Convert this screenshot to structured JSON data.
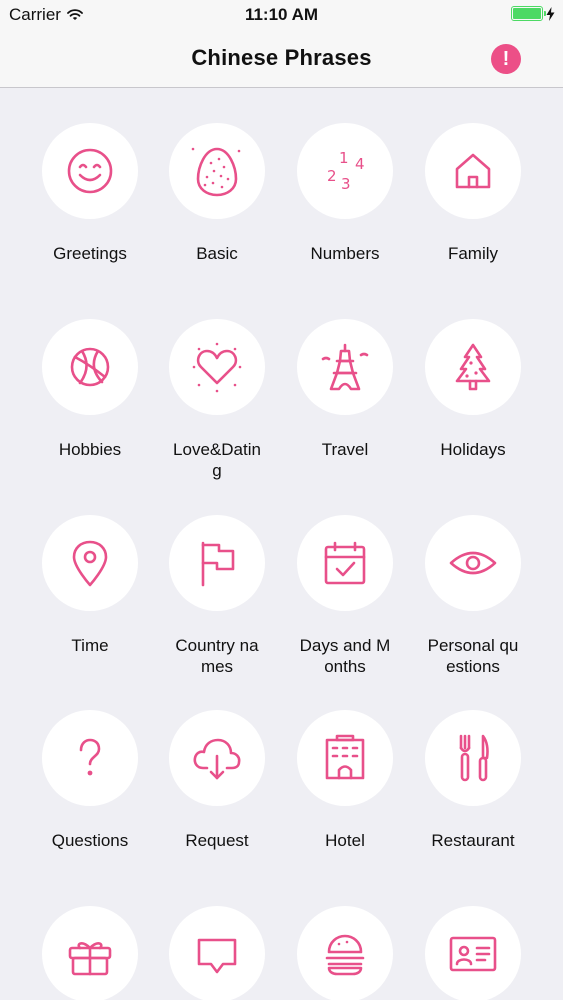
{
  "status_bar": {
    "carrier": "Carrier",
    "time": "11:10 AM"
  },
  "nav": {
    "title": "Chinese Phrases",
    "info_icon": "exclamation-icon",
    "info_glyph": "!"
  },
  "accent_color": "#e8508a",
  "categories": [
    {
      "label": "Greetings",
      "icon": "smiley-icon"
    },
    {
      "label": "Basic",
      "icon": "egg-icon"
    },
    {
      "label": "Numbers",
      "icon": "numbers-icon"
    },
    {
      "label": "Family",
      "icon": "house-icon"
    },
    {
      "label": "Hobbies",
      "icon": "basketball-icon"
    },
    {
      "label": "Love&Dating",
      "icon": "heart-icon"
    },
    {
      "label": "Travel",
      "icon": "eiffel-tower-icon"
    },
    {
      "label": "Holidays",
      "icon": "christmas-tree-icon"
    },
    {
      "label": "Time",
      "icon": "location-pin-icon"
    },
    {
      "label": "Country names",
      "icon": "flag-icon"
    },
    {
      "label": "Days and Months",
      "icon": "calendar-icon"
    },
    {
      "label": "Personal questions",
      "icon": "eye-icon"
    },
    {
      "label": "Questions",
      "icon": "question-mark-icon"
    },
    {
      "label": "Request",
      "icon": "cloud-download-icon"
    },
    {
      "label": "Hotel",
      "icon": "hotel-icon"
    },
    {
      "label": "Restaurant",
      "icon": "fork-knife-icon"
    },
    {
      "label": "",
      "icon": "gift-icon"
    },
    {
      "label": "",
      "icon": "chat-bubble-icon"
    },
    {
      "label": "",
      "icon": "burger-icon"
    },
    {
      "label": "",
      "icon": "id-card-icon"
    }
  ]
}
